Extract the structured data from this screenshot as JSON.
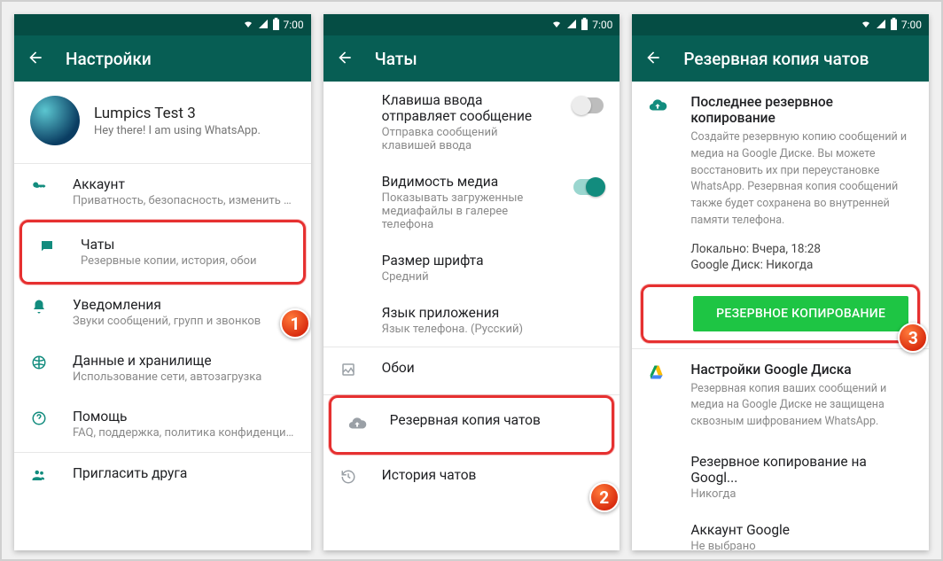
{
  "status": {
    "time": "7:00"
  },
  "screen1": {
    "title": "Настройки",
    "profile": {
      "name": "Lumpics Test 3",
      "status": "Hey there! I am using WhatsApp."
    },
    "items": {
      "account": {
        "title": "Аккаунт",
        "sub": "Приватность, безопасность, изменить но..."
      },
      "chats": {
        "title": "Чаты",
        "sub": "Резервные копии, история, обои"
      },
      "notif": {
        "title": "Уведомления",
        "sub": "Звуки сообщений, групп и звонков"
      },
      "data": {
        "title": "Данные и хранилище",
        "sub": "Использование сети, автозагрузка"
      },
      "help": {
        "title": "Помощь",
        "sub": "FAQ, поддержка, политика конфиденциал..."
      },
      "invite": {
        "title": "Пригласить друга"
      }
    },
    "badge": "1"
  },
  "screen2": {
    "title": "Чаты",
    "enterSend": {
      "title": "Клавиша ввода отправляет сообщение",
      "sub": "Отправка сообщений клавишей ввода",
      "on": false
    },
    "mediaVis": {
      "title": "Видимость медиа",
      "sub": "Показывать загруженные медиафайлы в галерее телефона",
      "on": true
    },
    "fontSize": {
      "title": "Размер шрифта",
      "sub": "Средний"
    },
    "lang": {
      "title": "Язык приложения",
      "sub": "Язык телефона. (Русский)"
    },
    "wallpaper": {
      "title": "Обои"
    },
    "backup": {
      "title": "Резервная копия чатов"
    },
    "history": {
      "title": "История чатов"
    },
    "badge": "2"
  },
  "screen3": {
    "title": "Резервная копия чатов",
    "lastBackup": {
      "heading": "Последнее резервное копирование",
      "desc": "Создайте резервную копию сообщений и медиа на Google Диске. Вы можете восстановить их при переустановке WhatsApp. Резервная копия сообщений также будет сохранена во внутренней памяти телефона.",
      "localLabel": "Локально:",
      "localVal": "Вчера, 18:28",
      "gdLabel": "Google Диск:",
      "gdVal": "Никогда"
    },
    "button": "РЕЗЕРВНОЕ КОПИРОВАНИЕ",
    "gdrive": {
      "heading": "Настройки Google Диска",
      "desc": "Резервная копия ваших сообщений и медиа на Google Диске не защищена сквозным шифрованием WhatsApp."
    },
    "freq": {
      "title": "Резервное копирование на Googl...",
      "sub": "Никогда"
    },
    "acct": {
      "title": "Аккаунт Google",
      "sub": "Не выбрано"
    },
    "badge": "3"
  }
}
